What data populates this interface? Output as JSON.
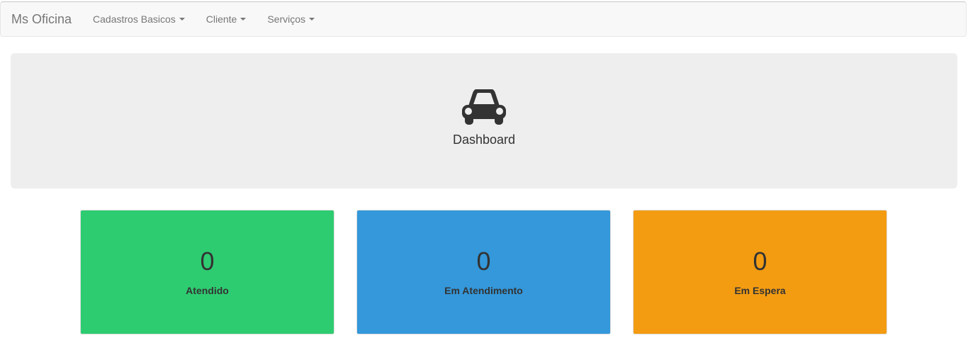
{
  "navbar": {
    "brand": "Ms Oficina",
    "items": [
      {
        "label": "Cadastros Basicos"
      },
      {
        "label": "Cliente"
      },
      {
        "label": "Serviços"
      }
    ]
  },
  "jumbotron": {
    "icon": "car-icon",
    "title": "Dashboard"
  },
  "cards": [
    {
      "value": "0",
      "label": "Atendido",
      "color": "#2ecc71"
    },
    {
      "value": "0",
      "label": "Em Atendimento",
      "color": "#3498db"
    },
    {
      "value": "0",
      "label": "Em Espera",
      "color": "#f39c12"
    }
  ]
}
